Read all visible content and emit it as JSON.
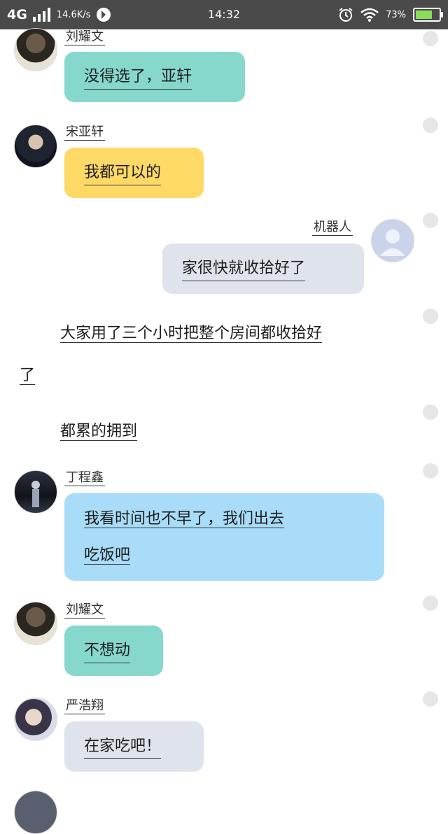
{
  "status_bar": {
    "network": "4G",
    "speed": "14.6K/s",
    "time": "14:32",
    "battery_percent": "73%",
    "battery_level": 0.73,
    "icons": [
      "signal-bars-icon",
      "data-activity-icon",
      "alarm-icon",
      "wifi-icon",
      "battery-icon"
    ]
  },
  "colors": {
    "teal_bubble": "#86d8cc",
    "yellow_bubble": "#ffd966",
    "gray_bubble": "#dfe4ec",
    "blue_bubble": "#a8dcf8",
    "status_bar": "#4a4a4a"
  },
  "messages": [
    {
      "sender": "刘耀文",
      "text": "没得选了，亚轩"
    },
    {
      "sender": "宋亚轩",
      "text": "我都可以的"
    },
    {
      "sender": "机器人",
      "text": "家很快就收拾好了"
    },
    {
      "narration_1": "大家用了三个小时把整个房间都收拾好",
      "narration_2": "了",
      "narration_3": "都累的拥到"
    },
    {
      "sender": "丁程鑫",
      "text_line1": "我看时间也不早了，我们出去",
      "text_line2": "吃饭吧"
    },
    {
      "sender": "刘耀文",
      "text": "不想动"
    },
    {
      "sender": "严浩翔",
      "text": "在家吃吧！"
    }
  ]
}
